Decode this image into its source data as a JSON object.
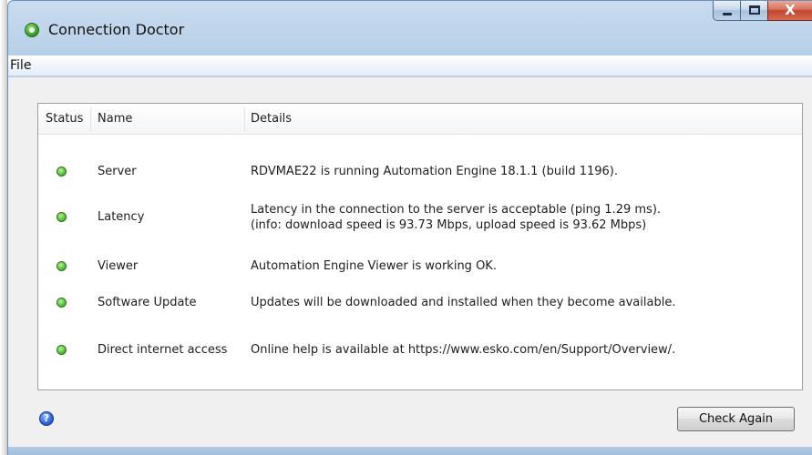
{
  "window": {
    "title": "Connection Doctor",
    "close_glyph": "X"
  },
  "menu": {
    "file": "File"
  },
  "table": {
    "headers": {
      "status": "Status",
      "name": "Name",
      "details": "Details"
    },
    "rows": [
      {
        "status": "ok",
        "name": "Server",
        "details": [
          "RDVMAE22 is running Automation Engine 18.1.1 (build 1196)."
        ]
      },
      {
        "status": "ok",
        "name": "Latency",
        "details": [
          "Latency in the connection to the server is acceptable (ping 1.29 ms).",
          "(info: download speed is 93.73 Mbps, upload speed is 93.62 Mbps)"
        ]
      },
      {
        "status": "ok",
        "name": "Viewer",
        "details": [
          "Automation Engine Viewer is working OK."
        ]
      },
      {
        "status": "ok",
        "name": "Software Update",
        "details": [
          "Updates will be downloaded and installed when they become available."
        ]
      },
      {
        "status": "ok",
        "name": "Direct internet access",
        "details": [
          "Online help is available at https://www.esko.com/en/Support/Overview/."
        ]
      }
    ]
  },
  "footer": {
    "help_glyph": "?",
    "check_again": "Check Again"
  },
  "colors": {
    "status_ok": "#4cb82f",
    "help_icon": "#2d63d6",
    "close_button": "#c0462f"
  },
  "icons": {
    "app": "green-power-icon",
    "help": "question-icon"
  }
}
